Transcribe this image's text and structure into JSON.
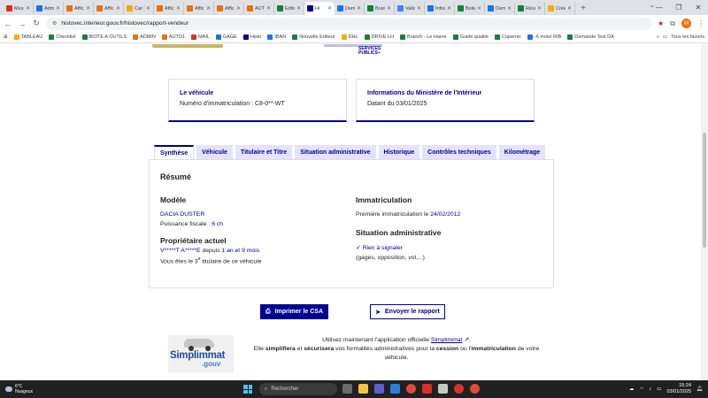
{
  "browser": {
    "tabs": [
      {
        "label": "Messa",
        "color": "#d93025"
      },
      {
        "label": "Admin",
        "color": "#1a73e8"
      },
      {
        "label": "Affich",
        "color": "#e8710a"
      },
      {
        "label": "Affich",
        "color": "#e8710a"
      },
      {
        "label": "Car Di",
        "color": "#f9ab00"
      },
      {
        "label": "Affich",
        "color": "#e8710a"
      },
      {
        "label": "Affich",
        "color": "#e8710a"
      },
      {
        "label": "Affich",
        "color": "#e8710a"
      },
      {
        "label": "AUTO1",
        "color": "#e8710a"
      },
      {
        "label": "Editeu",
        "color": "#188038"
      },
      {
        "label": "Hi",
        "color": "#000091",
        "active": true
      },
      {
        "label": "Dema",
        "color": "#1a73e8"
      },
      {
        "label": "Branch",
        "color": "#188038"
      },
      {
        "label": "Valida",
        "color": "#4285f4"
      },
      {
        "label": "Infos",
        "color": "#1a73e8"
      },
      {
        "label": "Boite",
        "color": "#188038"
      },
      {
        "label": "Dema",
        "color": "#1a73e8"
      },
      {
        "label": "Résult",
        "color": "#188038"
      },
      {
        "label": "Créer",
        "color": "#f9ab00"
      }
    ],
    "url": "histovec.interieur.gouv.fr/histovec/rapport-vendeur",
    "profile_initial": "M",
    "bookmarks": [
      {
        "label": "TABLEAU",
        "color": "#f9ab00"
      },
      {
        "label": "Checklist",
        "color": "#188038"
      },
      {
        "label": "BOITE A OUTILS",
        "color": "#188038"
      },
      {
        "label": "ADMIN",
        "color": "#e8710a"
      },
      {
        "label": "AUTO1",
        "color": "#e8710a"
      },
      {
        "label": "MAIL",
        "color": "#d93025"
      },
      {
        "label": "GAGE",
        "color": "#1a73e8"
      },
      {
        "label": "Histo",
        "color": "#000091"
      },
      {
        "label": "IBAN",
        "color": "#1a73e8"
      },
      {
        "label": "Nouvelle Editeur",
        "color": "#188038"
      },
      {
        "label": "DHL",
        "color": "#f9ab00"
      },
      {
        "label": "DRIVE LH",
        "color": "#188038"
      },
      {
        "label": "Branch - Le Havre",
        "color": "#188038"
      },
      {
        "label": "Guide qualité",
        "color": "#188038"
      },
      {
        "label": "Copernic",
        "color": "#188038"
      },
      {
        "label": "-6 mois/ RIB",
        "color": "#1a73e8"
      },
      {
        "label": "Demande Test DA",
        "color": "#188038"
      }
    ],
    "all_bookmarks": "Tous les favoris"
  },
  "vehicle_card": {
    "title": "Le véhicule",
    "text": "Numéro d'immatriculation : C8-0**-WT"
  },
  "ministry_card": {
    "title": "Informations du Ministère de l'Intérieur",
    "text": "Datant du 03/01/2025"
  },
  "tabs": [
    "Synthèse",
    "Véhicule",
    "Titulaire et Titre",
    "Situation administrative",
    "Historique",
    "Contrôles techniques",
    "Kilométrage"
  ],
  "summary": {
    "heading": "Résumé",
    "model_heading": "Modèle",
    "model_name": "DACIA DUSTER",
    "power_label": "Puissance fiscale : ",
    "power_value": "6 ch",
    "owner_heading": "Propriétaire actuel",
    "owner_name": "V*****T A*****E",
    "owner_since_label": " depuis ",
    "owner_since_value": "1 an et 9 mois",
    "holder_prefix": "Vous êtes le ",
    "holder_rank": "3",
    "holder_sup": "e",
    "holder_suffix": " titulaire de ce véhicule",
    "registration_heading": "Immatriculation",
    "first_reg_label": "Première immatriculation le ",
    "first_reg_date": "24/02/2012",
    "admin_heading": "Situation administrative",
    "admin_status": "Rien à signaler",
    "admin_details": "(gages, opposition, vol,...)"
  },
  "actions": {
    "print": "Imprimer le CSA",
    "send": "Envoyer le rapport"
  },
  "promo": {
    "brand": "Simplimmat",
    "brand_suffix": ".gouv",
    "line1_prefix": "Utilisez maintenant l'application officielle ",
    "app_link": "Simplimmat",
    "line2_a": "Elle ",
    "simplify": "simplifiera",
    "line2_b": " et ",
    "secure": "sécurisera",
    "line2_c": " vos formalités administratives pour la ",
    "cession": "cession",
    "line2_d": " ou l'",
    "immat": "immatriculation",
    "line2_e": " de votre véhicule."
  },
  "taskbar": {
    "temp": "6°C",
    "weather": "Nuageux",
    "search_placeholder": "Rechercher",
    "time": "15:24",
    "date": "03/01/2025"
  }
}
